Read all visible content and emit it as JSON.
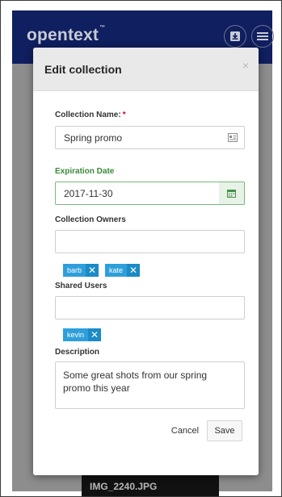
{
  "app": {
    "brand": "opentext",
    "trademark": "™"
  },
  "background": {
    "thumbnail_label": "IMG_2240.JPG"
  },
  "modal": {
    "title": "Edit collection",
    "close_label": "×",
    "collection_name": {
      "label": "Collection Name:",
      "required_mark": "*",
      "value": "Spring promo"
    },
    "expiration_date": {
      "label": "Expiration Date",
      "value": "2017-11-30"
    },
    "collection_owners": {
      "label": "Collection Owners",
      "value": "",
      "tags": [
        "barb",
        "kate"
      ]
    },
    "shared_users": {
      "label": "Shared Users",
      "value": "",
      "tags": [
        "kevin"
      ]
    },
    "description": {
      "label": "Description",
      "value": "Some great shots from our spring promo this year"
    },
    "buttons": {
      "cancel": "Cancel",
      "save": "Save"
    },
    "tag_remove_glyph": "✕"
  },
  "colors": {
    "header": "#0f1f5f",
    "tag": "#2e9fdb",
    "valid_green": "#3b8a3b",
    "required_red": "#d0021b"
  }
}
